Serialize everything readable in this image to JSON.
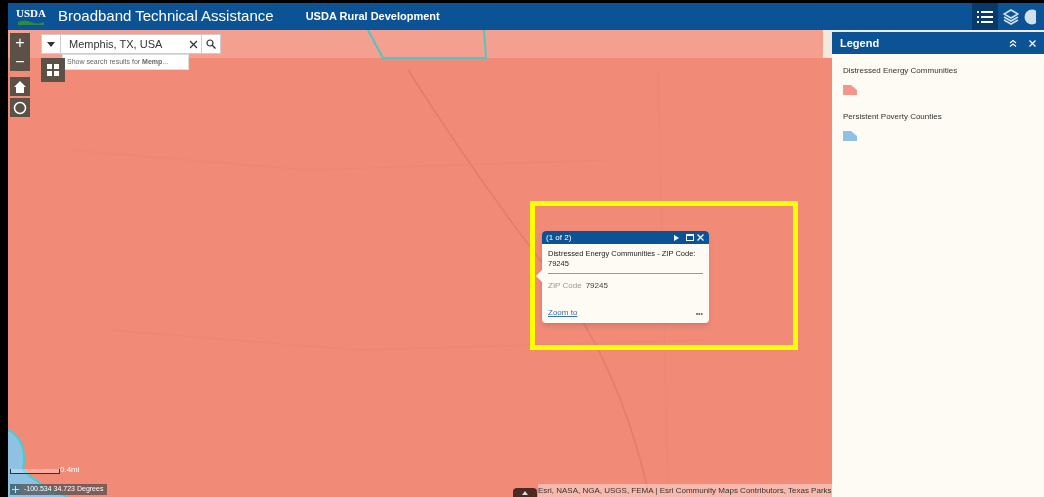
{
  "header": {
    "logo": "USDA",
    "title": "Broadband Technical Assistance",
    "subtitle": "USDA Rural Development"
  },
  "map_controls": {
    "zoom_in": "+",
    "zoom_out": "−"
  },
  "search": {
    "value": "Memphis, TX, USA",
    "suggestion": "Show search results for **Memp**..."
  },
  "legend": {
    "title": "Legend",
    "items": [
      {
        "label": "Distressed Energy Communities",
        "color": "#f4978a"
      },
      {
        "label": "Persistent Poverty Counties",
        "color": "#8fc1e3"
      }
    ]
  },
  "popup": {
    "counter": "(1 of 2)",
    "title": "Distressed Energy Communities - ZIP Code: 79245",
    "field_label": "ZIP Code",
    "field_value": "79245",
    "link": "Zoom to",
    "more": "•••"
  },
  "scale": "0.4mi",
  "coordinates": "-100.534 34.723 Degrees",
  "attribution": "Esri, NASA, NGA, USGS, FEMA | Esri Community Maps Contributors, Texas Parks"
}
